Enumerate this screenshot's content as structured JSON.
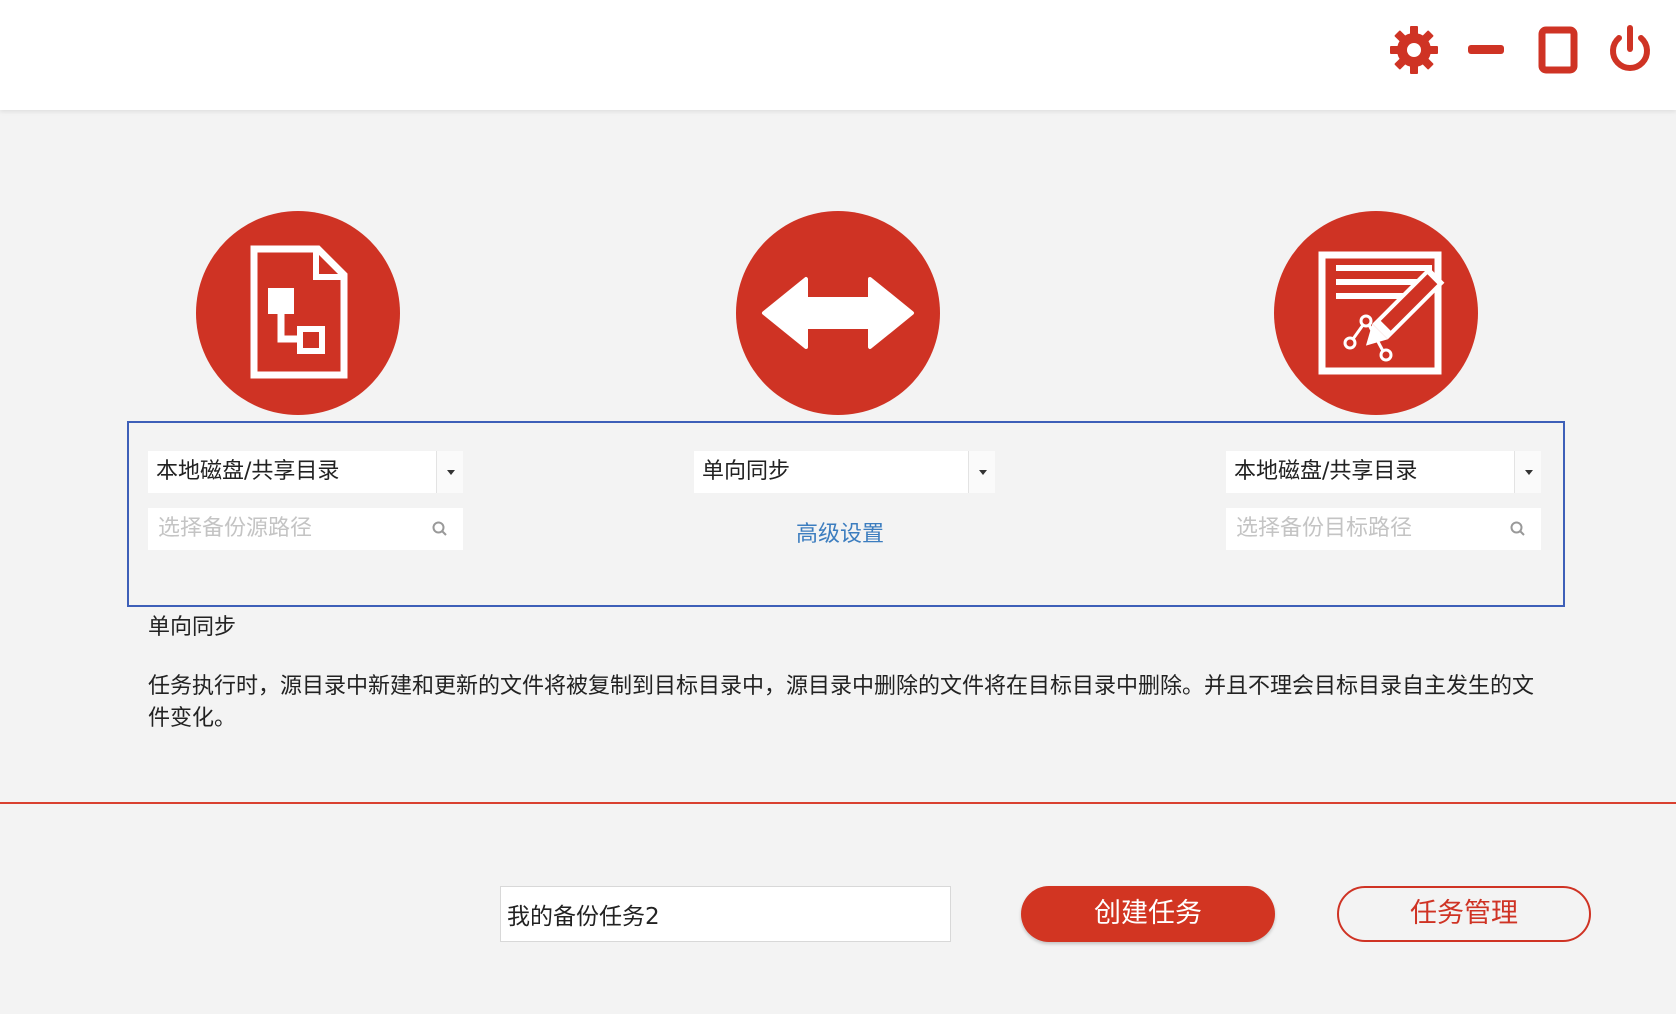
{
  "titlebar": {
    "settings_icon": "gear-icon",
    "minimize_icon": "minimize-icon",
    "maximize_icon": "maximize-icon",
    "power_icon": "power-icon",
    "icon_color": "#cf3324"
  },
  "illustrations": {
    "source": "document-tree-icon",
    "sync_mode": "double-arrow-icon",
    "target": "edit-document-icon",
    "color": "#cf3324"
  },
  "source": {
    "type_select": "本地磁盘/共享目录",
    "path_placeholder": "选择备份源路径"
  },
  "sync": {
    "mode_select": "单向同步",
    "advanced_link": "高级设置"
  },
  "target": {
    "type_select": "本地磁盘/共享目录",
    "path_placeholder": "选择备份目标路径"
  },
  "mode_info": {
    "title": "单向同步",
    "description": "任务执行时，源目录中新建和更新的文件将被复制到目标目录中，源目录中删除的文件将在目标目录中删除。并且不理会目标目录自主发生的文件变化。"
  },
  "footer": {
    "task_name_value": "我的备份任务2",
    "create_button": "创建任务",
    "manage_button": "任务管理"
  },
  "colors": {
    "accent": "#cf3324",
    "link": "#3c7dbf",
    "frame": "#3d5fb8"
  }
}
